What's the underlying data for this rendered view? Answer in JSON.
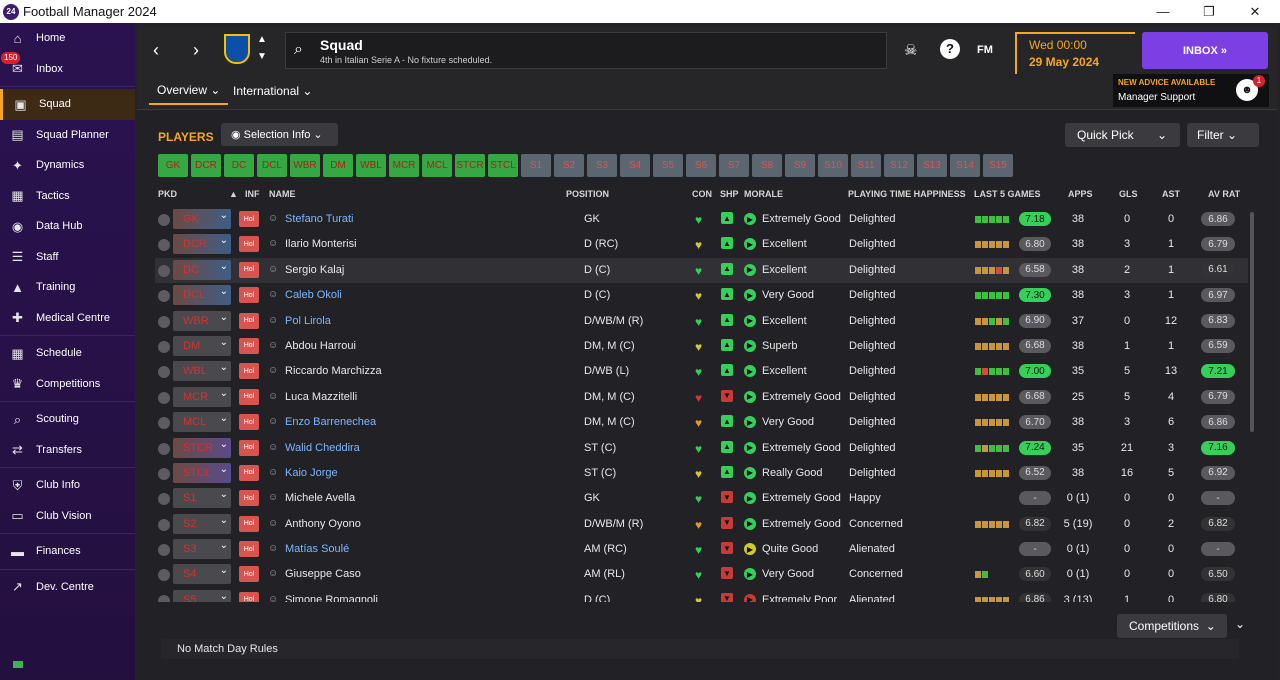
{
  "window": {
    "title": "Football Manager 2024",
    "logo": "24"
  },
  "sidebar": {
    "items": [
      {
        "label": "Home",
        "icon": "⌂"
      },
      {
        "label": "Inbox",
        "icon": "✉",
        "badge": "150"
      },
      {
        "label": "Squad",
        "icon": "▣",
        "active": true
      },
      {
        "label": "Squad Planner",
        "icon": "▤"
      },
      {
        "label": "Dynamics",
        "icon": "✦"
      },
      {
        "label": "Tactics",
        "icon": "▦"
      },
      {
        "label": "Data Hub",
        "icon": "◉"
      },
      {
        "label": "Staff",
        "icon": "☰"
      },
      {
        "label": "Training",
        "icon": "▲"
      },
      {
        "label": "Medical Centre",
        "icon": "✚"
      },
      {
        "label": "Schedule",
        "icon": "▦"
      },
      {
        "label": "Competitions",
        "icon": "♛"
      },
      {
        "label": "Scouting",
        "icon": "⌕"
      },
      {
        "label": "Transfers",
        "icon": "⇄"
      },
      {
        "label": "Club Info",
        "icon": "⛨"
      },
      {
        "label": "Club Vision",
        "icon": "▭"
      },
      {
        "label": "Finances",
        "icon": "▬"
      },
      {
        "label": "Dev. Centre",
        "icon": "↗"
      }
    ]
  },
  "header": {
    "title": "Squad",
    "subtitle": "4th in Italian Serie A - No fixture scheduled.",
    "tabs": [
      "Overview",
      "International"
    ],
    "fm_label": "FM",
    "date_line1": "Wed 00:00",
    "date_line2": "29 May 2024",
    "inbox_label": "INBOX",
    "advice_title": "NEW ADVICE AVAILABLE",
    "advice_sub": "Manager Support",
    "advice_count": "1"
  },
  "toolbar": {
    "players": "PLAYERS",
    "selection_info": "Selection Info",
    "quick_pick": "Quick Pick",
    "filter": "Filter"
  },
  "chips": {
    "green": [
      "GK",
      "DCR",
      "DC",
      "DCL",
      "WBR",
      "DM",
      "WBL",
      "MCR",
      "MCL",
      "STCR",
      "STCL"
    ],
    "grey": [
      "S1",
      "S2",
      "S3",
      "S4",
      "S5",
      "S6",
      "S7",
      "S8",
      "S9",
      "S10",
      "S11",
      "S12",
      "S13",
      "S14",
      "S15"
    ]
  },
  "columns": {
    "pkd": "PKD",
    "inf": "INF",
    "name": "NAME",
    "position": "POSITION",
    "con": "CON",
    "shp": "SHP",
    "morale": "MORALE",
    "pth": "PLAYING TIME HAPPINESS",
    "last5": "LAST 5 GAMES",
    "apps": "APPS",
    "gls": "GLS",
    "ast": "AST",
    "avrat": "AV RAT"
  },
  "colors": {
    "accent": "#f5a623",
    "inbox": "#7b3fe4",
    "green": "#35a845",
    "link": "#7db6ff"
  },
  "players": [
    {
      "pos": "GK",
      "pbox": "pr",
      "inf": "Hol",
      "name": "Stefano Turati",
      "link": true,
      "position": "GK",
      "con": "green",
      "shp": "green",
      "morale": "Extremely Good",
      "mi": "green",
      "pth": "Delighted",
      "l5": [
        "g",
        "g",
        "g",
        "g",
        "g"
      ],
      "rating": "7.18",
      "rcls": "green",
      "apps": "38",
      "gls": "0",
      "ast": "0",
      "av": "6.86",
      "acls": "grey"
    },
    {
      "pos": "DCR",
      "pbox": "pr",
      "inf": "Hol",
      "name": "Ilario Monterisi",
      "link": false,
      "position": "D (RC)",
      "con": "yellow",
      "shp": "green",
      "morale": "Excellent",
      "mi": "green",
      "pth": "Delighted",
      "l5": [
        "o",
        "o",
        "o",
        "o",
        "o"
      ],
      "rating": "6.80",
      "rcls": "grey",
      "apps": "38",
      "gls": "3",
      "ast": "1",
      "av": "6.79",
      "acls": "grey"
    },
    {
      "pos": "DC",
      "pbox": "pr",
      "inf": "Hol",
      "name": "Sergio Kalaj",
      "link": false,
      "position": "D (C)",
      "con": "green",
      "shp": "green",
      "morale": "Excellent",
      "mi": "green",
      "pth": "Delighted",
      "l5": [
        "o",
        "o",
        "o",
        "r",
        "o"
      ],
      "rating": "6.58",
      "rcls": "grey",
      "apps": "38",
      "gls": "2",
      "ast": "1",
      "av": "6.61",
      "acls": "dark",
      "hl": true
    },
    {
      "pos": "DCL",
      "pbox": "pr",
      "inf": "Hol",
      "name": "Caleb Okoli",
      "link": true,
      "position": "D (C)",
      "con": "yellow",
      "shp": "green",
      "morale": "Very Good",
      "mi": "green",
      "pth": "Delighted",
      "l5": [
        "g",
        "g",
        "g",
        "g",
        "g"
      ],
      "rating": "7.30",
      "rcls": "green",
      "apps": "38",
      "gls": "3",
      "ast": "1",
      "av": "6.97",
      "acls": "grey"
    },
    {
      "pos": "WBR",
      "pbox": "ps",
      "inf": "Hol",
      "name": "Pol Lirola",
      "link": true,
      "position": "D/WB/M (R)",
      "con": "green",
      "shp": "green",
      "morale": "Excellent",
      "mi": "green",
      "pth": "Delighted",
      "l5": [
        "o",
        "o",
        "g",
        "o",
        "g"
      ],
      "rating": "6.90",
      "rcls": "grey",
      "apps": "37",
      "gls": "0",
      "ast": "12",
      "av": "6.83",
      "acls": "grey"
    },
    {
      "pos": "DM",
      "pbox": "ps",
      "inf": "Hol",
      "name": "Abdou Harroui",
      "link": false,
      "position": "DM, M (C)",
      "con": "yellow",
      "shp": "green",
      "morale": "Superb",
      "mi": "green",
      "pth": "Delighted",
      "l5": [
        "o",
        "o",
        "o",
        "o",
        "o"
      ],
      "rating": "6.68",
      "rcls": "grey",
      "apps": "38",
      "gls": "1",
      "ast": "1",
      "av": "6.59",
      "acls": "grey"
    },
    {
      "pos": "WBL",
      "pbox": "ps",
      "inf": "Hol",
      "name": "Riccardo Marchizza",
      "link": false,
      "position": "D/WB (L)",
      "con": "green",
      "shp": "green",
      "morale": "Excellent",
      "mi": "green",
      "pth": "Delighted",
      "l5": [
        "g",
        "r",
        "g",
        "g",
        "g"
      ],
      "rating": "7.00",
      "rcls": "green",
      "apps": "35",
      "gls": "5",
      "ast": "13",
      "av": "7.21",
      "acls": "green"
    },
    {
      "pos": "MCR",
      "pbox": "ps",
      "inf": "Hol",
      "name": "Luca Mazzitelli",
      "link": false,
      "position": "DM, M (C)",
      "con": "red",
      "shp": "red",
      "morale": "Extremely Good",
      "mi": "green",
      "pth": "Delighted",
      "l5": [
        "o",
        "o",
        "o",
        "o",
        "o"
      ],
      "rating": "6.68",
      "rcls": "grey",
      "apps": "25",
      "gls": "5",
      "ast": "4",
      "av": "6.79",
      "acls": "grey"
    },
    {
      "pos": "MCL",
      "pbox": "ps",
      "inf": "Hol",
      "name": "Enzo Barrenechea",
      "link": true,
      "position": "DM, M (C)",
      "con": "orange",
      "shp": "green",
      "morale": "Very Good",
      "mi": "green",
      "pth": "Delighted",
      "l5": [
        "o",
        "o",
        "o",
        "o",
        "o"
      ],
      "rating": "6.70",
      "rcls": "grey",
      "apps": "38",
      "gls": "3",
      "ast": "6",
      "av": "6.86",
      "acls": "grey"
    },
    {
      "pos": "STCR",
      "pbox": "pp",
      "inf": "Hol",
      "name": "Walid Cheddira",
      "link": true,
      "position": "ST (C)",
      "con": "green",
      "shp": "green",
      "morale": "Extremely Good",
      "mi": "green",
      "pth": "Delighted",
      "l5": [
        "g",
        "o",
        "g",
        "g",
        "g"
      ],
      "rating": "7.24",
      "rcls": "green",
      "apps": "35",
      "gls": "21",
      "ast": "3",
      "av": "7.16",
      "acls": "green"
    },
    {
      "pos": "STCL",
      "pbox": "pp",
      "inf": "Hol",
      "name": "Kaio Jorge",
      "link": true,
      "position": "ST (C)",
      "con": "yellow",
      "shp": "green",
      "morale": "Really Good",
      "mi": "green",
      "pth": "Delighted",
      "l5": [
        "o",
        "o",
        "o",
        "o",
        "o"
      ],
      "rating": "6.52",
      "rcls": "grey",
      "apps": "38",
      "gls": "16",
      "ast": "5",
      "av": "6.92",
      "acls": "grey"
    },
    {
      "pos": "S1",
      "pbox": "ps",
      "inf": "Hol",
      "name": "Michele Avella",
      "link": false,
      "position": "GK",
      "con": "green",
      "shp": "red",
      "morale": "Extremely Good",
      "mi": "green",
      "pth": "Happy",
      "l5": [],
      "rating": "-",
      "rcls": "grey",
      "apps": "0 (1)",
      "gls": "0",
      "ast": "0",
      "av": "-",
      "acls": "grey"
    },
    {
      "pos": "S2",
      "pbox": "ps",
      "inf": "Hol",
      "name": "Anthony Oyono",
      "link": false,
      "position": "D/WB/M (R)",
      "con": "orange",
      "shp": "red",
      "morale": "Extremely Good",
      "mi": "green",
      "pth": "Concerned",
      "l5": [
        "o",
        "o",
        "o",
        "o",
        "o"
      ],
      "rating": "6.82",
      "rcls": "dark",
      "apps": "5 (19)",
      "gls": "0",
      "ast": "2",
      "av": "6.82",
      "acls": "dark"
    },
    {
      "pos": "S3",
      "pbox": "ps",
      "inf": "Hol",
      "name": "Matías Soulé",
      "link": true,
      "position": "AM (RC)",
      "con": "green",
      "shp": "red",
      "morale": "Quite Good",
      "mi": "yellow",
      "pth": "Alienated",
      "l5": [],
      "rating": "-",
      "rcls": "grey",
      "apps": "0 (1)",
      "gls": "0",
      "ast": "0",
      "av": "-",
      "acls": "grey"
    },
    {
      "pos": "S4",
      "pbox": "ps",
      "inf": "Hol",
      "name": "Giuseppe Caso",
      "link": false,
      "position": "AM (RL)",
      "con": "green",
      "shp": "red",
      "morale": "Very Good",
      "mi": "green",
      "pth": "Concerned",
      "l5": [
        "o",
        "g"
      ],
      "rating": "6.60",
      "rcls": "dark",
      "apps": "0 (1)",
      "gls": "0",
      "ast": "0",
      "av": "6.50",
      "acls": "dark"
    },
    {
      "pos": "S5",
      "pbox": "ps",
      "inf": "Hol",
      "name": "Simone Romagnoli",
      "link": false,
      "position": "D (C)",
      "con": "yellow",
      "shp": "red",
      "morale": "Extremely Poor",
      "mi": "red",
      "pth": "Alienated",
      "l5": [
        "o",
        "o",
        "o",
        "o",
        "o"
      ],
      "rating": "6.86",
      "rcls": "dark",
      "apps": "3 (13)",
      "gls": "1",
      "ast": "0",
      "av": "6.80",
      "acls": "dark"
    }
  ],
  "footer": {
    "competitions": "Competitions",
    "rules": "No Match Day Rules"
  }
}
